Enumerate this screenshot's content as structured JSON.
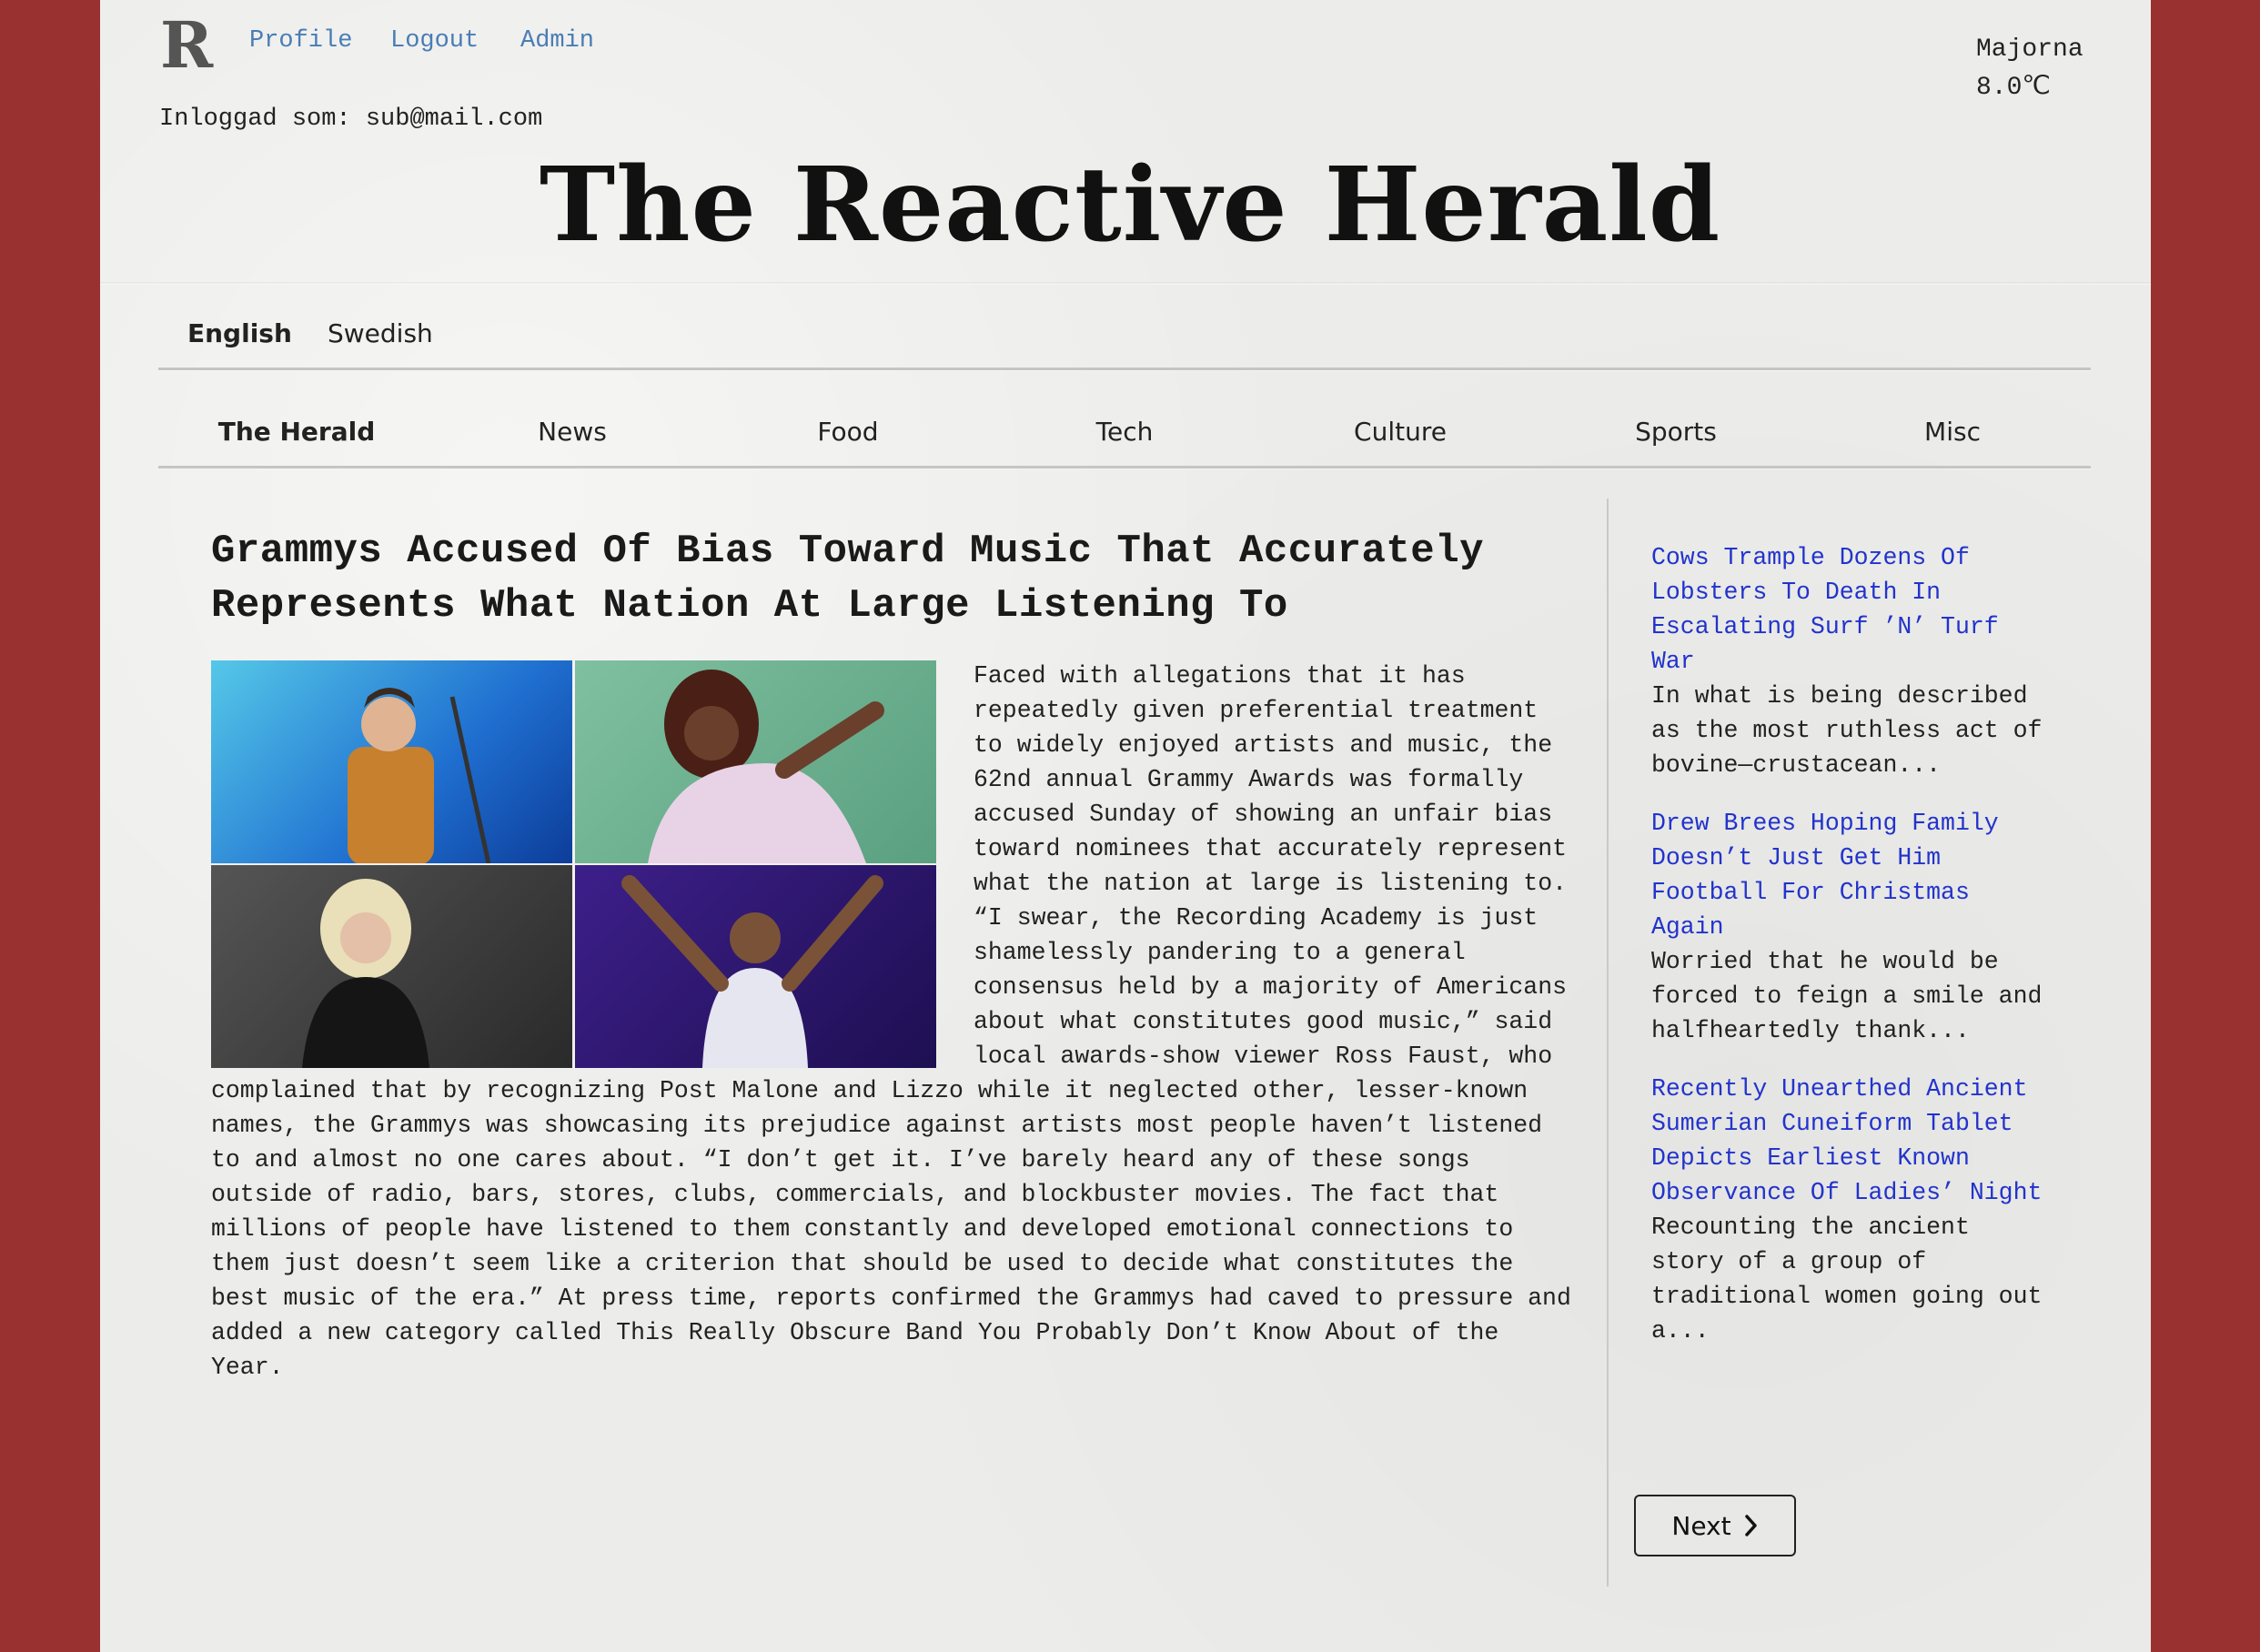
{
  "topnav": {
    "profile": "Profile",
    "logout": "Logout",
    "admin": "Admin"
  },
  "logo_letter": "R",
  "logged_in": "Inloggad som: sub@mail.com",
  "weather": {
    "location": "Majorna",
    "temperature": "8.0℃"
  },
  "masthead": "The Reactive Herald",
  "languages": [
    "English",
    "Swedish"
  ],
  "categories": [
    "The Herald",
    "News",
    "Food",
    "Tech",
    "Culture",
    "Sports",
    "Misc"
  ],
  "article": {
    "title": "Grammys Accused Of Bias Toward Music That Accurately Represents What Nation At Large Listening To",
    "body": "Faced with allegations that it has repeatedly given preferential treatment to widely enjoyed artists and music, the 62nd annual Grammy Awards was formally accused Sunday of showing an unfair bias toward nominees that accurately represent what the nation at large is listening to. “I swear, the Recording Academy is just shamelessly pandering to a general consensus held by a majority of Americans about what constitutes good music,” said local awards-show viewer Ross Faust, who complained that by recognizing Post Malone and Lizzo while it neglected other, lesser-known names, the Grammys was showcasing its prejudice against artists most people haven’t listened to and almost no one cares about. “I don’t get it. I’ve barely heard any of these songs outside of radio, bars, stores, clubs, commercials, and blockbuster movies. The fact that millions of people have listened to them constantly and developed emotional connections to them just doesn’t seem like a criterion that should be used to decide what constitutes the best music of the era.” At press time, reports confirmed the Grammys had caved to pressure and added a new category called This Really Obscure Band You Probably Don’t Know About of the Year."
  },
  "sidebar": [
    {
      "title": "Cows Trample Dozens Of Lobsters To Death In Escalating Surf ’N’ Turf War",
      "snippet": "In what is being described as the most ruthless act of bovine—crustacean..."
    },
    {
      "title": "Drew Brees Hoping Family Doesn’t Just Get Him Football For Christmas Again",
      "snippet": "Worried that he would be forced to feign a smile and halfheartedly thank..."
    },
    {
      "title": "Recently Unearthed Ancient Sumerian Cuneiform Tablet Depicts Earliest Known Observance Of Ladies’ Night",
      "snippet": "Recounting the ancient story of a group of traditional women going out a..."
    }
  ],
  "next_label": "Next",
  "colors": {
    "background": "#9a3131",
    "link": "#4a7db5",
    "sidebar_link": "#2233cc",
    "paper": "#ececea"
  }
}
